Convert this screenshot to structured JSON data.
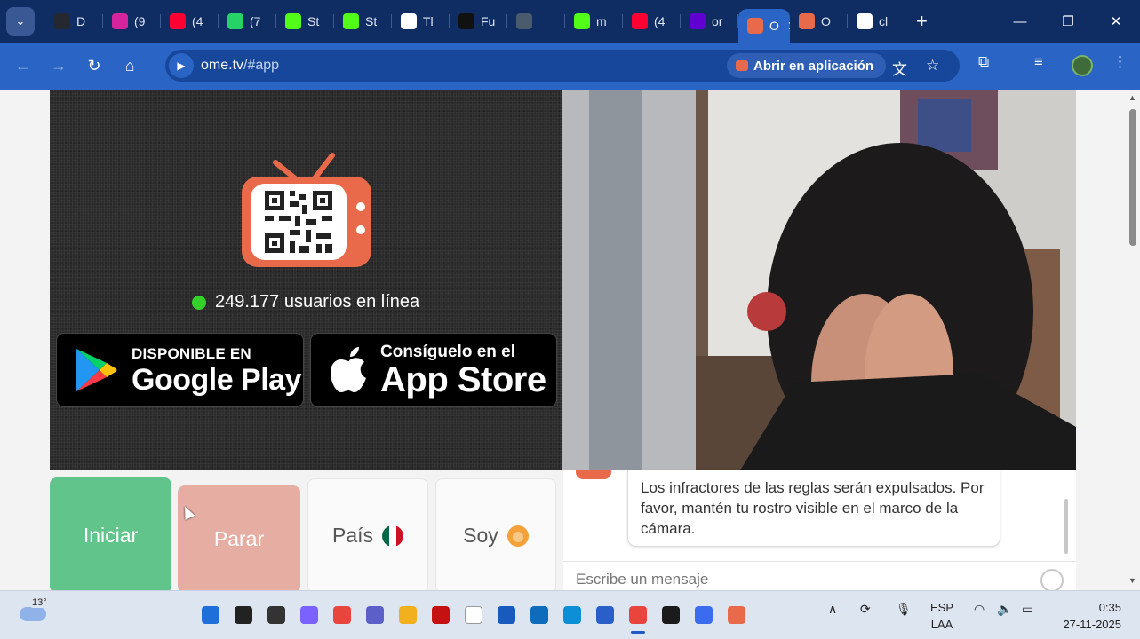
{
  "browser": {
    "tabs": [
      {
        "label": "D",
        "icon": "github-icon",
        "color": "#24292f"
      },
      {
        "label": "(9",
        "icon": "instagram-icon",
        "color": "#d6249f"
      },
      {
        "label": "(4",
        "icon": "youtube-icon",
        "color": "#ff0033"
      },
      {
        "label": "(7",
        "icon": "whatsapp-icon",
        "color": "#25d366"
      },
      {
        "label": "St",
        "icon": "kick-icon",
        "color": "#53fc18"
      },
      {
        "label": "St",
        "icon": "kick-icon",
        "color": "#53fc18"
      },
      {
        "label": "Tl",
        "icon": "diamond-icon",
        "color": "#ffffff"
      },
      {
        "label": "Fu",
        "icon": "fu-icon",
        "color": "#111111"
      },
      {
        "label": "",
        "icon": "owl-icon",
        "color": "#4a5b6e"
      },
      {
        "label": "m",
        "icon": "kick-icon",
        "color": "#53fc18"
      },
      {
        "label": "(4",
        "icon": "youtube-icon",
        "color": "#ff0033"
      },
      {
        "label": "or",
        "icon": "yahoo-icon",
        "color": "#6001d2"
      },
      {
        "label": "O",
        "icon": "ometv-icon",
        "color": "#e96a4a",
        "active": true
      },
      {
        "label": "O",
        "icon": "ometv-icon",
        "color": "#e96a4a"
      },
      {
        "label": "cl",
        "icon": "globe-icon",
        "color": "#ffffff"
      }
    ],
    "url_host": "ome.tv",
    "url_path": "/#app",
    "open_app_label": "Abrir en aplicación"
  },
  "page": {
    "online_count": "249.177 usuarios en línea",
    "google_play": {
      "small": "DISPONIBLE EN",
      "big": "Google Play"
    },
    "app_store": {
      "small": "Consíguelo en el",
      "big": "App Store"
    },
    "buttons": {
      "start": "Iniciar",
      "stop": "Parar",
      "country": "País",
      "gender": "Soy"
    },
    "chat": {
      "message": "Los infractores de las reglas serán expulsados. Por favor, mantén tu rostro visible en el marco de la cámara.",
      "input_placeholder": "Escribe un mensaje"
    }
  },
  "taskbar": {
    "temperature": "13°",
    "lang_top": "ESP",
    "lang_bottom": "LAA",
    "time": "0:35",
    "date": "27-11-2025",
    "apps": [
      {
        "name": "windows-start-icon",
        "color": "#1e6fd9"
      },
      {
        "name": "search-icon",
        "color": "#222222"
      },
      {
        "name": "task-view-icon",
        "color": "#333333"
      },
      {
        "name": "copilot-icon",
        "color": "#7b61ff"
      },
      {
        "name": "chrome-icon",
        "color": "#e8453c"
      },
      {
        "name": "teams-icon",
        "color": "#5b5fc7"
      },
      {
        "name": "file-explorer-icon",
        "color": "#f2b01e"
      },
      {
        "name": "among-us-icon",
        "color": "#c51111"
      },
      {
        "name": "blank-file-icon",
        "color": "#ffffff"
      },
      {
        "name": "word-icon",
        "color": "#185abd"
      },
      {
        "name": "outlook-icon",
        "color": "#0f6cbd"
      },
      {
        "name": "edge-icon",
        "color": "#0c8fd6"
      },
      {
        "name": "store-icon",
        "color": "#2a5ec8"
      },
      {
        "name": "chrome-active-icon",
        "color": "#e8453c",
        "active": true
      },
      {
        "name": "steam-like-icon",
        "color": "#1b1b1b"
      },
      {
        "name": "app-blue-icon",
        "color": "#3b6cf0"
      },
      {
        "name": "ometv-app-icon",
        "color": "#e96a4a"
      }
    ]
  }
}
